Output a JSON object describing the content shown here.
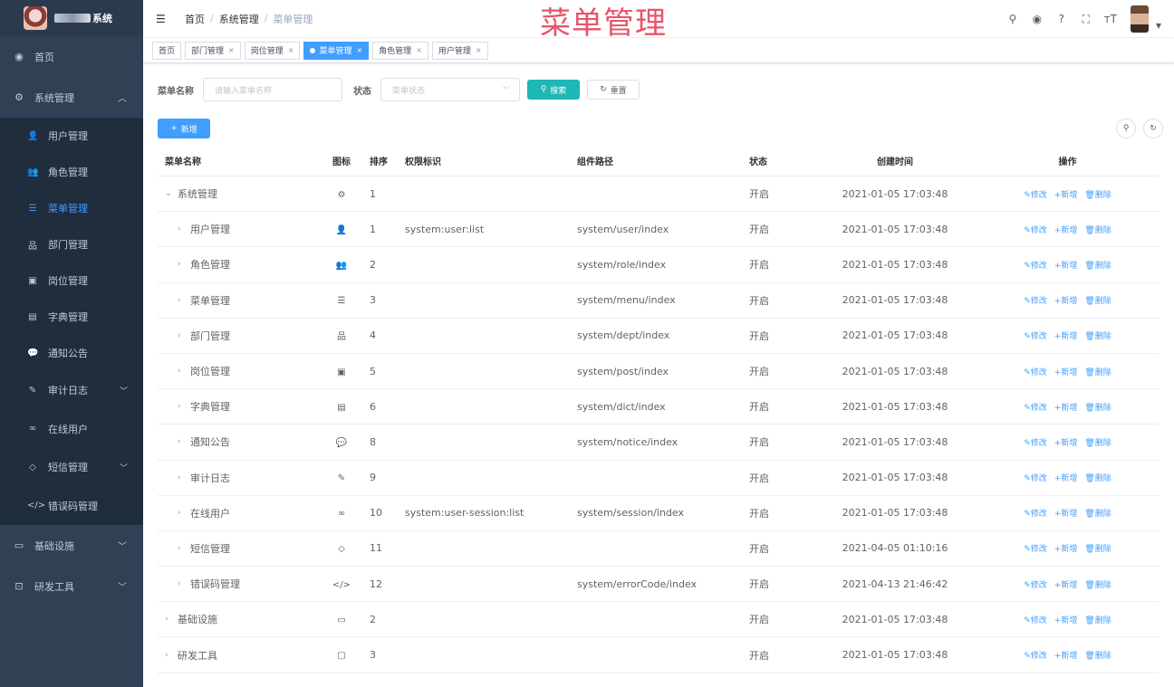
{
  "app": {
    "logo_text": "系统"
  },
  "sidebar": {
    "home": "首页",
    "system": "系统管理",
    "items": [
      {
        "label": "用户管理",
        "icon": "user-icon",
        "glyph": "👤"
      },
      {
        "label": "角色管理",
        "icon": "peoples-icon",
        "glyph": "👥"
      },
      {
        "label": "菜单管理",
        "icon": "tree-table-icon",
        "glyph": "☰"
      },
      {
        "label": "部门管理",
        "icon": "tree-icon",
        "glyph": "品"
      },
      {
        "label": "岗位管理",
        "icon": "post-icon",
        "glyph": "▣"
      },
      {
        "label": "字典管理",
        "icon": "dict-icon",
        "glyph": "▤"
      },
      {
        "label": "通知公告",
        "icon": "message-icon",
        "glyph": "💬"
      },
      {
        "label": "审计日志",
        "icon": "log-icon",
        "glyph": "✎"
      },
      {
        "label": "在线用户",
        "icon": "online-icon",
        "glyph": "∞"
      },
      {
        "label": "短信管理",
        "icon": "validcode-icon",
        "glyph": "◇"
      },
      {
        "label": "错误码管理",
        "icon": "code-icon",
        "glyph": "</>"
      }
    ],
    "infra": "基础设施",
    "tool": "研发工具"
  },
  "header": {
    "breadcrumb": [
      "首页",
      "系统管理",
      "菜单管理"
    ],
    "watermark": "菜单管理"
  },
  "tags": [
    {
      "label": "首页",
      "closable": false,
      "active": false
    },
    {
      "label": "部门管理",
      "closable": true,
      "active": false
    },
    {
      "label": "岗位管理",
      "closable": true,
      "active": false
    },
    {
      "label": "菜单管理",
      "closable": true,
      "active": true
    },
    {
      "label": "角色管理",
      "closable": true,
      "active": false
    },
    {
      "label": "用户管理",
      "closable": true,
      "active": false
    }
  ],
  "search": {
    "name_label": "菜单名称",
    "name_placeholder": "请输入菜单名称",
    "status_label": "状态",
    "status_placeholder": "菜单状态",
    "search_button": "搜索",
    "reset_button": "重置",
    "add_button": "新增"
  },
  "table": {
    "columns": [
      "菜单名称",
      "图标",
      "排序",
      "权限标识",
      "组件路径",
      "状态",
      "创建时间",
      "操作"
    ],
    "ops": [
      "修改",
      "新增",
      "删除"
    ],
    "rows": [
      {
        "name": "系统管理",
        "expand": "⌄",
        "glyph": "⚙",
        "sort": "1",
        "perm": "",
        "comp": "",
        "status": "开启",
        "time": "2021-01-05 17:03:48",
        "child": false
      },
      {
        "name": "用户管理",
        "expand": "›",
        "glyph": "👤",
        "sort": "1",
        "perm": "system:user:list",
        "comp": "system/user/index",
        "status": "开启",
        "time": "2021-01-05 17:03:48",
        "child": true
      },
      {
        "name": "角色管理",
        "expand": "›",
        "glyph": "👥",
        "sort": "2",
        "perm": "",
        "comp": "system/role/index",
        "status": "开启",
        "time": "2021-01-05 17:03:48",
        "child": true
      },
      {
        "name": "菜单管理",
        "expand": "›",
        "glyph": "☰",
        "sort": "3",
        "perm": "",
        "comp": "system/menu/index",
        "status": "开启",
        "time": "2021-01-05 17:03:48",
        "child": true
      },
      {
        "name": "部门管理",
        "expand": "›",
        "glyph": "品",
        "sort": "4",
        "perm": "",
        "comp": "system/dept/index",
        "status": "开启",
        "time": "2021-01-05 17:03:48",
        "child": true
      },
      {
        "name": "岗位管理",
        "expand": "›",
        "glyph": "▣",
        "sort": "5",
        "perm": "",
        "comp": "system/post/index",
        "status": "开启",
        "time": "2021-01-05 17:03:48",
        "child": true
      },
      {
        "name": "字典管理",
        "expand": "›",
        "glyph": "▤",
        "sort": "6",
        "perm": "",
        "comp": "system/dict/index",
        "status": "开启",
        "time": "2021-01-05 17:03:48",
        "child": true
      },
      {
        "name": "通知公告",
        "expand": "›",
        "glyph": "💬",
        "sort": "8",
        "perm": "",
        "comp": "system/notice/index",
        "status": "开启",
        "time": "2021-01-05 17:03:48",
        "child": true
      },
      {
        "name": "审计日志",
        "expand": "›",
        "glyph": "✎",
        "sort": "9",
        "perm": "",
        "comp": "",
        "status": "开启",
        "time": "2021-01-05 17:03:48",
        "child": true
      },
      {
        "name": "在线用户",
        "expand": "›",
        "glyph": "∞",
        "sort": "10",
        "perm": "system:user-session:list",
        "comp": "system/session/index",
        "status": "开启",
        "time": "2021-01-05 17:03:48",
        "child": true
      },
      {
        "name": "短信管理",
        "expand": "›",
        "glyph": "◇",
        "sort": "11",
        "perm": "",
        "comp": "",
        "status": "开启",
        "time": "2021-04-05 01:10:16",
        "child": true
      },
      {
        "name": "错误码管理",
        "expand": "›",
        "glyph": "</>",
        "sort": "12",
        "perm": "",
        "comp": "system/errorCode/index",
        "status": "开启",
        "time": "2021-04-13 21:46:42",
        "child": true
      },
      {
        "name": "基础设施",
        "expand": "›",
        "glyph": "▭",
        "sort": "2",
        "perm": "",
        "comp": "",
        "status": "开启",
        "time": "2021-01-05 17:03:48",
        "child": false
      },
      {
        "name": "研发工具",
        "expand": "›",
        "glyph": "▢",
        "sort": "3",
        "perm": "",
        "comp": "",
        "status": "开启",
        "time": "2021-01-05 17:03:48",
        "child": false
      }
    ]
  }
}
